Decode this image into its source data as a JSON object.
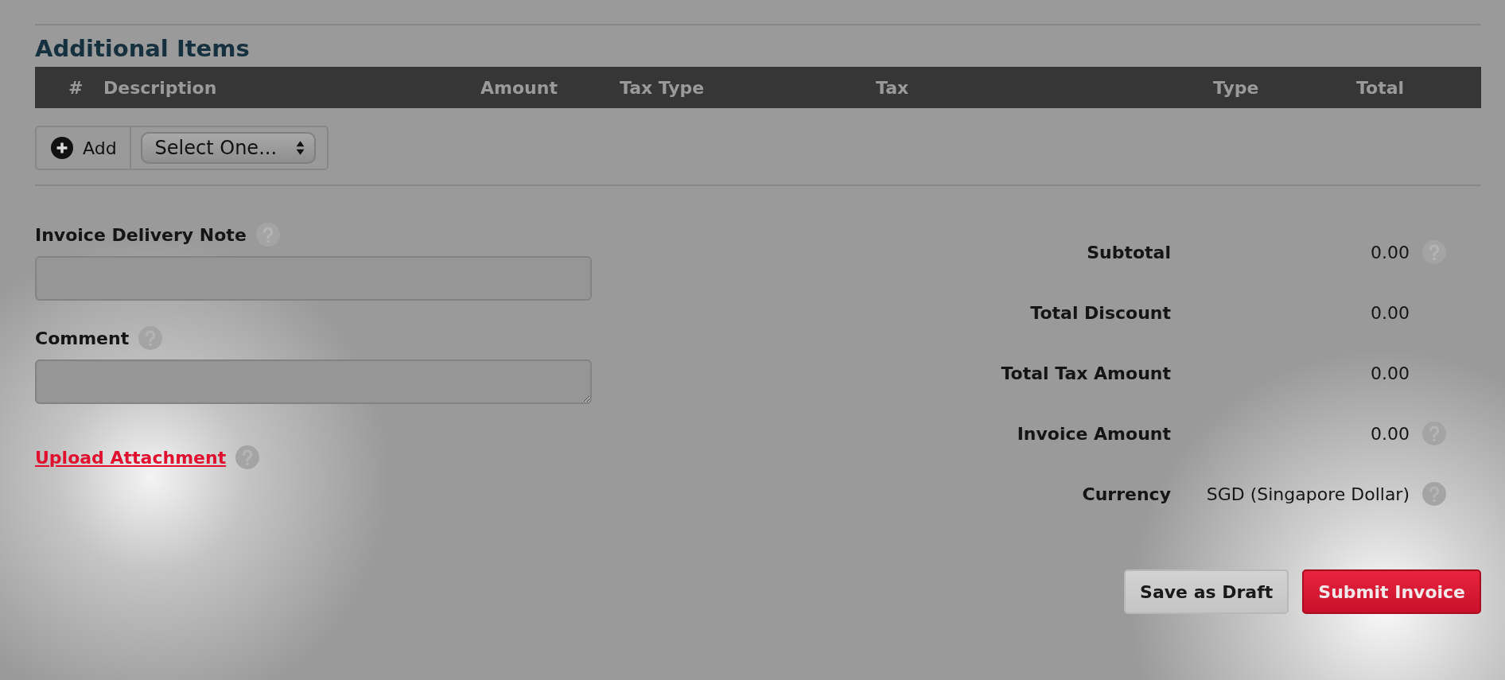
{
  "section_title": "Additional Items",
  "table": {
    "columns": [
      "#",
      "Description",
      "Amount",
      "Tax Type",
      "Tax",
      "Type",
      "Total"
    ]
  },
  "add_button": {
    "label": "Add"
  },
  "item_select": {
    "value": "Select One..."
  },
  "fields": [
    {
      "label": "Invoice Delivery Note",
      "kind": "input",
      "help": true
    },
    {
      "label": "Comment",
      "kind": "textarea",
      "help": true
    }
  ],
  "upload_link": {
    "label": "Upload Attachment",
    "help": true
  },
  "totals": [
    {
      "label": "Subtotal",
      "value": "0.00",
      "help": true
    },
    {
      "label": "Total Discount",
      "value": "0.00",
      "help": false
    },
    {
      "label": "Total Tax Amount",
      "value": "0.00",
      "help": false
    },
    {
      "label": "Invoice Amount",
      "value": "0.00",
      "help": true
    },
    {
      "label": "Currency",
      "value": "SGD (Singapore Dollar)",
      "help": true
    }
  ],
  "buttons": [
    {
      "label": "Save as Draft",
      "kind": "secondary"
    },
    {
      "label": "Submit Invoice",
      "kind": "primary"
    }
  ]
}
